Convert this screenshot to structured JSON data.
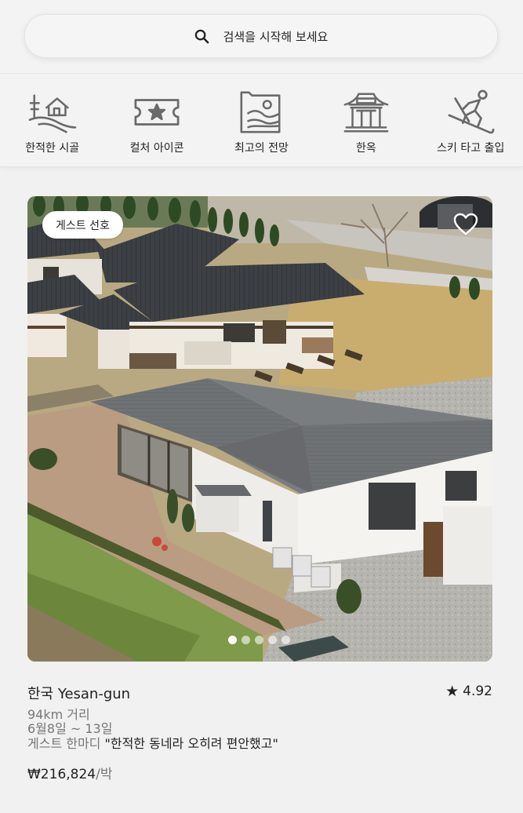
{
  "search": {
    "label": "검색을 시작해 보세요",
    "icon": "search-icon"
  },
  "categories": [
    {
      "label": "한적한 시골",
      "icon": "countryside-icon"
    },
    {
      "label": "컬처 아이콘",
      "icon": "ticket-star-icon"
    },
    {
      "label": "최고의 전망",
      "icon": "view-frame-icon"
    },
    {
      "label": "한옥",
      "icon": "hanok-icon"
    },
    {
      "label": "스키 타고 출입",
      "icon": "skier-icon"
    }
  ],
  "listing": {
    "badge": "게스트 선호",
    "wishlist_icon": "heart-icon",
    "photo_count": 5,
    "active_photo": 1,
    "title": "한국 Yesan-gun",
    "rating_icon": "star-icon",
    "rating": "4.92",
    "distance": "94km 거리",
    "dates": "6월8일 ~ 13일",
    "review_prefix": "게스트 한마디",
    "review_quote": "\"한적한 동네라 오히려 편안했고\"",
    "price": "₩216,824",
    "price_unit": "/박"
  }
}
